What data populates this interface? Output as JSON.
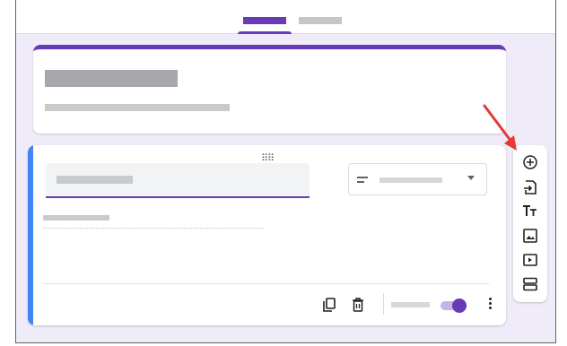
{
  "tabs": [
    {
      "id": "questions",
      "active": true
    },
    {
      "id": "responses",
      "active": false
    }
  ],
  "colors": {
    "accent": "#673ab7",
    "active_question": "#4285f4",
    "background": "#f0ebf8",
    "annotation_arrow": "#e53935"
  },
  "question_card": {
    "type_select_icon": "short-answer-lines-icon",
    "required_toggle_on": true
  },
  "footer_icons": [
    "duplicate-icon",
    "delete-icon",
    "more-vert-icon"
  ],
  "side_toolbar": {
    "tools": [
      "add-question-icon",
      "import-questions-icon",
      "add-title-icon",
      "add-image-icon",
      "add-video-icon",
      "add-section-icon"
    ]
  },
  "annotation": {
    "points_to": "add-question-icon"
  }
}
